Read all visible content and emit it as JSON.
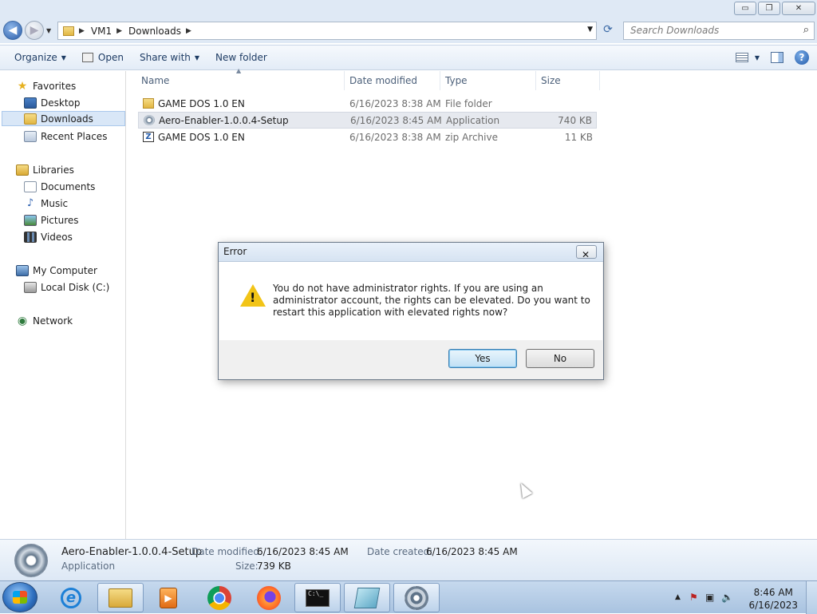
{
  "window": {
    "controls": {
      "minimize": "▭",
      "maximize": "❐",
      "close": "✕"
    }
  },
  "address": {
    "crumbs": [
      "VM1",
      "Downloads"
    ],
    "search_placeholder": "Search Downloads"
  },
  "toolbar": {
    "organize": "Organize",
    "open": "Open",
    "share_with": "Share with",
    "new_folder": "New folder"
  },
  "nav": {
    "favorites": "Favorites",
    "desktop": "Desktop",
    "downloads": "Downloads",
    "recent_places": "Recent Places",
    "libraries": "Libraries",
    "documents": "Documents",
    "music": "Music",
    "pictures": "Pictures",
    "videos": "Videos",
    "my_computer": "My Computer",
    "local_disk": "Local Disk (C:)",
    "network": "Network"
  },
  "columns": {
    "name": "Name",
    "date": "Date modified",
    "type": "Type",
    "size": "Size"
  },
  "files": [
    {
      "name": "GAME DOS 1.0 EN",
      "date": "6/16/2023 8:38 AM",
      "type": "File folder",
      "size": "",
      "icon": "folder-icon"
    },
    {
      "name": "Aero-Enabler-1.0.0.4-Setup",
      "date": "6/16/2023 8:45 AM",
      "type": "Application",
      "size": "740 KB",
      "icon": "setup-gear-icon"
    },
    {
      "name": "GAME DOS 1.0 EN",
      "date": "6/16/2023 8:38 AM",
      "type": "zip Archive",
      "size": "11 KB",
      "icon": "zip-icon"
    }
  ],
  "details": {
    "name": "Aero-Enabler-1.0.0.4-Setup",
    "kind": "Application",
    "date_modified_label": "Date modified:",
    "date_modified": "6/16/2023 8:45 AM",
    "date_created_label": "Date created:",
    "date_created": "6/16/2023 8:45 AM",
    "size_label": "Size:",
    "size": "739 KB"
  },
  "dialog": {
    "title": "Error",
    "message": "You do not have administrator rights. If you are using an administrator account, the rights can be elevated. Do you want to restart this application with elevated rights now?",
    "yes": "Yes",
    "no": "No"
  },
  "taskbar": {
    "cmd_text": "C:\\_",
    "time": "8:46 AM",
    "date": "6/16/2023"
  }
}
